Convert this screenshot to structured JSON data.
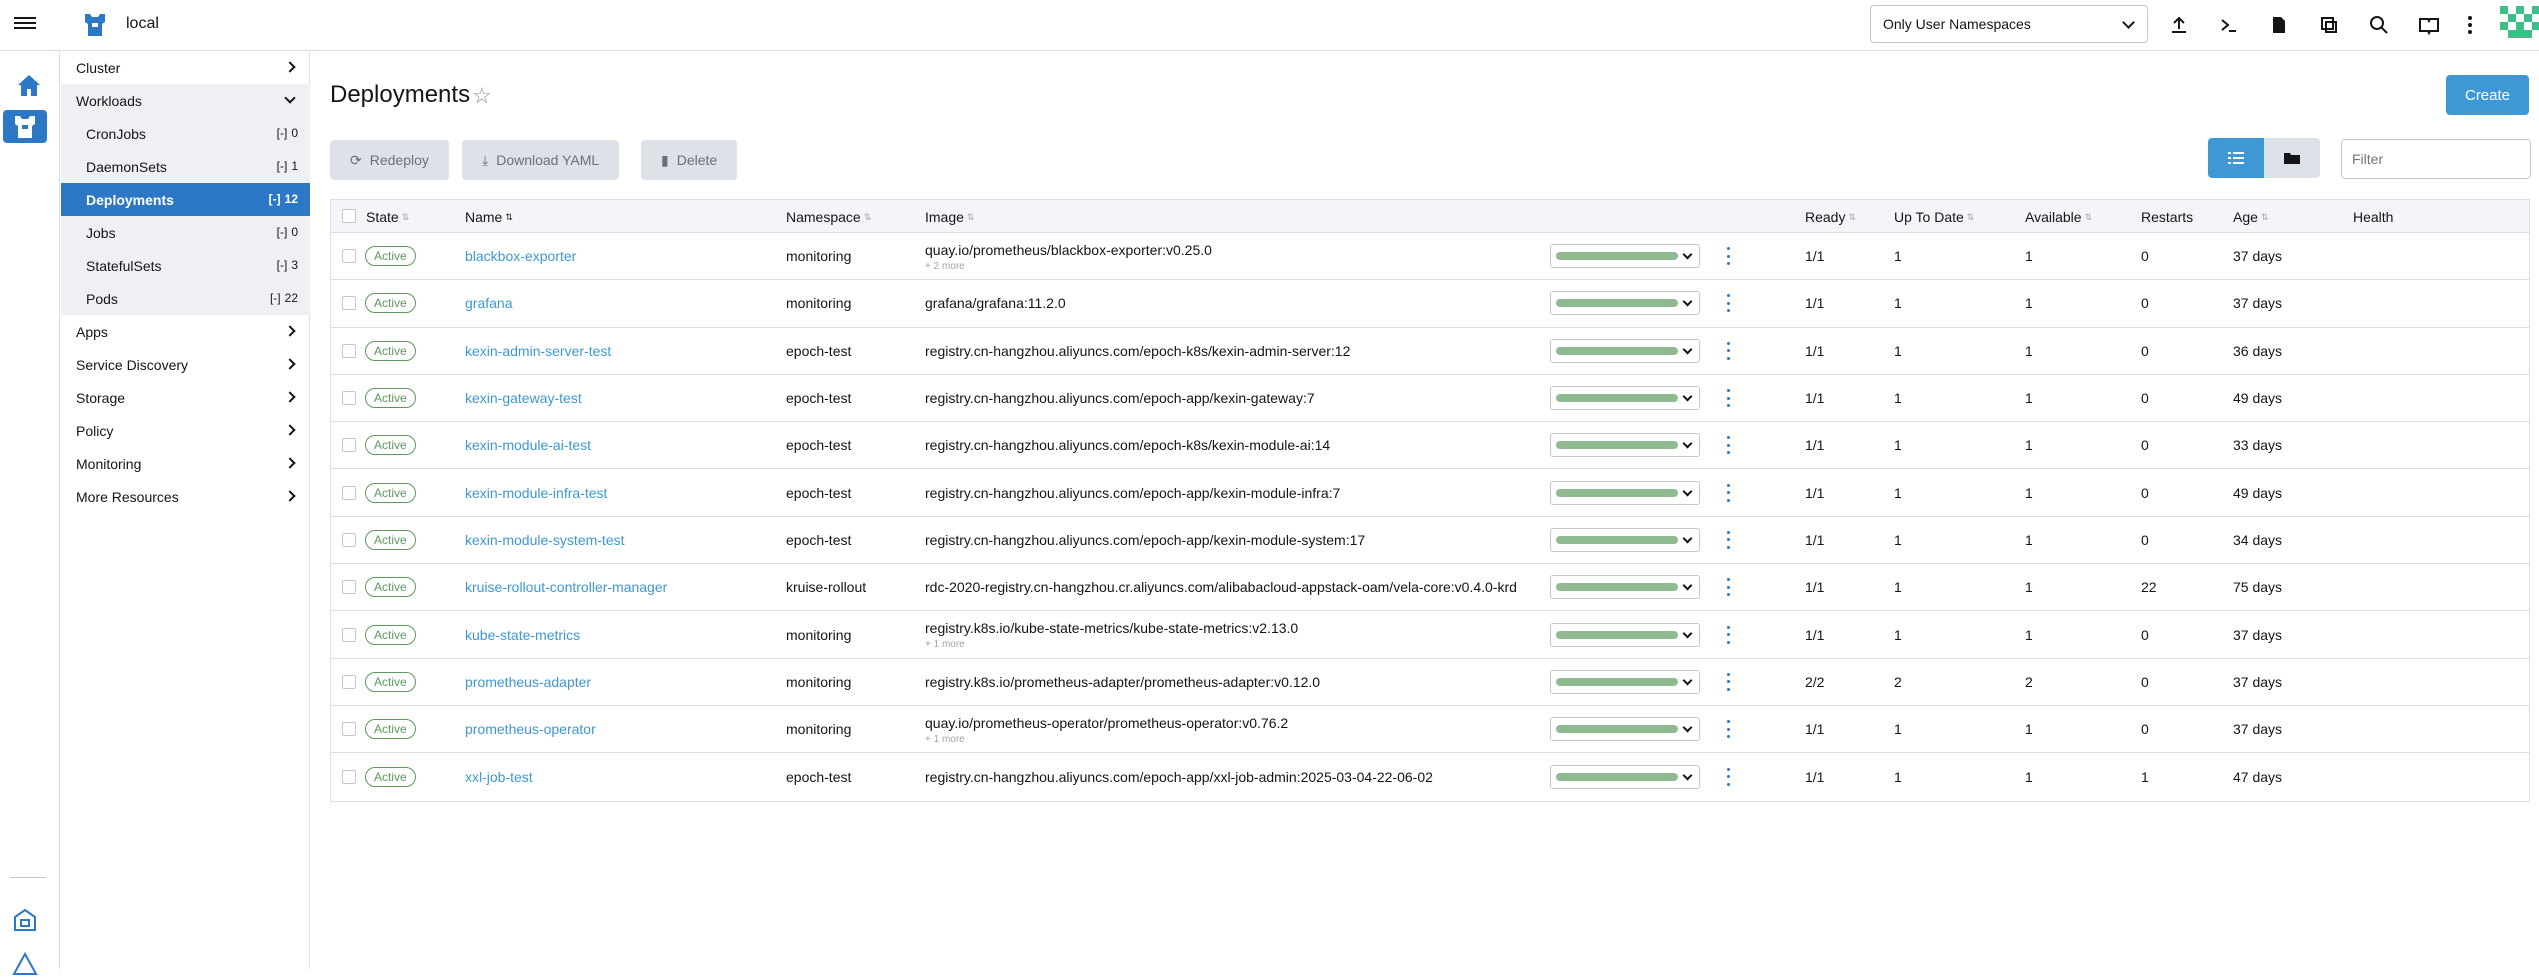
{
  "header": {
    "cluster_name": "local",
    "namespace_select": "Only User Namespaces",
    "icons": [
      "upload-icon",
      "terminal-icon",
      "file-icon",
      "copy-icon",
      "search-icon",
      "book-icon",
      "more-icon"
    ]
  },
  "sidebar": {
    "groups": [
      {
        "label": "Cluster"
      },
      {
        "label": "Workloads"
      },
      {
        "label": "Apps"
      },
      {
        "label": "Service Discovery"
      },
      {
        "label": "Storage"
      },
      {
        "label": "Policy"
      },
      {
        "label": "Monitoring"
      },
      {
        "label": "More Resources"
      }
    ],
    "workloads": [
      {
        "label": "CronJobs",
        "count": "0"
      },
      {
        "label": "DaemonSets",
        "count": "1"
      },
      {
        "label": "Deployments",
        "count": "12"
      },
      {
        "label": "Jobs",
        "count": "0"
      },
      {
        "label": "StatefulSets",
        "count": "3"
      },
      {
        "label": "Pods",
        "count": "22"
      }
    ]
  },
  "page": {
    "title": "Deployments",
    "create_label": "Create",
    "redeploy_label": "Redeploy",
    "download_label": "Download YAML",
    "delete_label": "Delete",
    "filter_placeholder": "Filter"
  },
  "table": {
    "headers": {
      "state": "State",
      "name": "Name",
      "namespace": "Namespace",
      "image": "Image",
      "ready": "Ready",
      "uptodate": "Up To Date",
      "available": "Available",
      "restarts": "Restarts",
      "age": "Age",
      "health": "Health"
    },
    "rows": [
      {
        "state": "Active",
        "name": "blackbox-exporter",
        "namespace": "monitoring",
        "image": "quay.io/prometheus/blackbox-exporter:v0.25.0",
        "more": "+ 2 more",
        "ready": "1/1",
        "uptodate": "1",
        "available": "1",
        "restarts": "0",
        "age": "37 days"
      },
      {
        "state": "Active",
        "name": "grafana",
        "namespace": "monitoring",
        "image": "grafana/grafana:11.2.0",
        "more": "",
        "ready": "1/1",
        "uptodate": "1",
        "available": "1",
        "restarts": "0",
        "age": "37 days"
      },
      {
        "state": "Active",
        "name": "kexin-admin-server-test",
        "namespace": "epoch-test",
        "image": "registry.cn-hangzhou.aliyuncs.com/epoch-k8s/kexin-admin-server:12",
        "more": "",
        "ready": "1/1",
        "uptodate": "1",
        "available": "1",
        "restarts": "0",
        "age": "36 days"
      },
      {
        "state": "Active",
        "name": "kexin-gateway-test",
        "namespace": "epoch-test",
        "image": "registry.cn-hangzhou.aliyuncs.com/epoch-app/kexin-gateway:7",
        "more": "",
        "ready": "1/1",
        "uptodate": "1",
        "available": "1",
        "restarts": "0",
        "age": "49 days"
      },
      {
        "state": "Active",
        "name": "kexin-module-ai-test",
        "namespace": "epoch-test",
        "image": "registry.cn-hangzhou.aliyuncs.com/epoch-k8s/kexin-module-ai:14",
        "more": "",
        "ready": "1/1",
        "uptodate": "1",
        "available": "1",
        "restarts": "0",
        "age": "33 days"
      },
      {
        "state": "Active",
        "name": "kexin-module-infra-test",
        "namespace": "epoch-test",
        "image": "registry.cn-hangzhou.aliyuncs.com/epoch-app/kexin-module-infra:7",
        "more": "",
        "ready": "1/1",
        "uptodate": "1",
        "available": "1",
        "restarts": "0",
        "age": "49 days"
      },
      {
        "state": "Active",
        "name": "kexin-module-system-test",
        "namespace": "epoch-test",
        "image": "registry.cn-hangzhou.aliyuncs.com/epoch-app/kexin-module-system:17",
        "more": "",
        "ready": "1/1",
        "uptodate": "1",
        "available": "1",
        "restarts": "0",
        "age": "34 days"
      },
      {
        "state": "Active",
        "name": "kruise-rollout-controller-manager",
        "namespace": "kruise-rollout",
        "image": "rdc-2020-registry.cn-hangzhou.cr.aliyuncs.com/alibabacloud-appstack-oam/vela-core:v0.4.0-krd",
        "more": "",
        "ready": "1/1",
        "uptodate": "1",
        "available": "1",
        "restarts": "22",
        "age": "75 days"
      },
      {
        "state": "Active",
        "name": "kube-state-metrics",
        "namespace": "monitoring",
        "image": "registry.k8s.io/kube-state-metrics/kube-state-metrics:v2.13.0",
        "more": "+ 1 more",
        "ready": "1/1",
        "uptodate": "1",
        "available": "1",
        "restarts": "0",
        "age": "37 days"
      },
      {
        "state": "Active",
        "name": "prometheus-adapter",
        "namespace": "monitoring",
        "image": "registry.k8s.io/prometheus-adapter/prometheus-adapter:v0.12.0",
        "more": "",
        "ready": "2/2",
        "uptodate": "2",
        "available": "2",
        "restarts": "0",
        "age": "37 days"
      },
      {
        "state": "Active",
        "name": "prometheus-operator",
        "namespace": "monitoring",
        "image": "quay.io/prometheus-operator/prometheus-operator:v0.76.2",
        "more": "+ 1 more",
        "ready": "1/1",
        "uptodate": "1",
        "available": "1",
        "restarts": "0",
        "age": "37 days"
      },
      {
        "state": "Active",
        "name": "xxl-job-test",
        "namespace": "epoch-test",
        "image": "registry.cn-hangzhou.aliyuncs.com/epoch-app/xxl-job-admin:2025-03-04-22-06-02",
        "more": "",
        "ready": "1/1",
        "uptodate": "1",
        "available": "1",
        "restarts": "1",
        "age": "47 days"
      }
    ]
  },
  "colors": {
    "accent": "#3d98d3",
    "nav_active": "#2d78c6",
    "active_badge": "#5d995d"
  }
}
